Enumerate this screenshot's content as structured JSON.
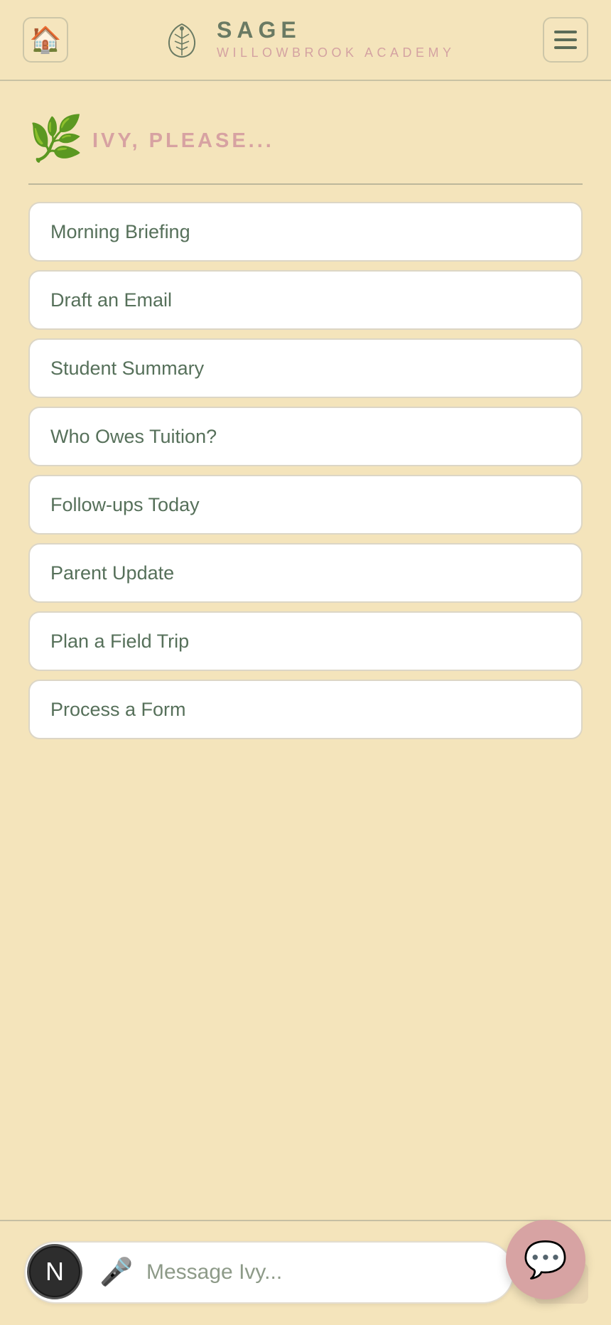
{
  "header": {
    "home_icon": "🏠",
    "brand_title": "SAGE",
    "brand_subtitle": "WILLOWBROOK ACADEMY",
    "menu_icon": "hamburger-menu"
  },
  "section": {
    "leaf_icon": "🌿",
    "title": "IVY, PLEASE..."
  },
  "actions": [
    "Morning Briefing",
    "Draft an Email",
    "Student Summary",
    "Who Owes Tuition?",
    "Follow-ups Today",
    "Parent Update",
    "Plan a Field Trip",
    "Process a Form"
  ],
  "composer": {
    "avatar_letter": "N",
    "mic_icon": "🎤",
    "placeholder": "Message Ivy...",
    "value": ""
  },
  "chat_fab_icon": "💬",
  "colors": {
    "background": "#f4e4bb",
    "accent_pink": "#d7a2a2",
    "text_green": "#56705a"
  }
}
